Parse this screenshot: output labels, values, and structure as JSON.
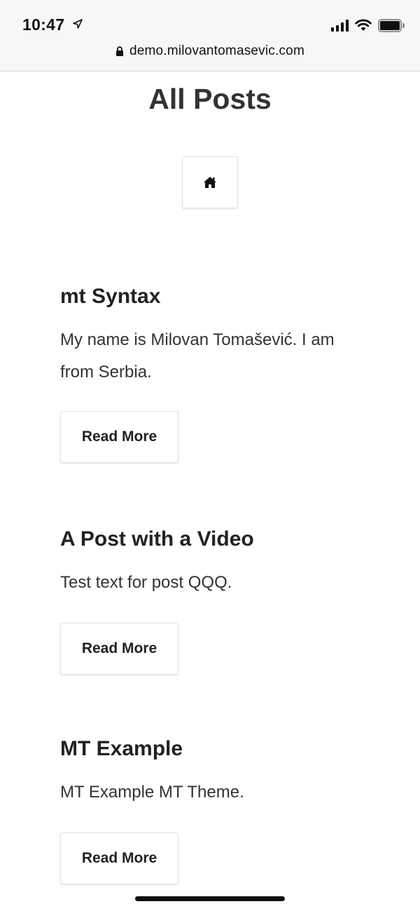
{
  "status_bar": {
    "time": "10:47"
  },
  "browser": {
    "url": "demo.milovantomasevic.com"
  },
  "page": {
    "title": "All Posts"
  },
  "posts": [
    {
      "title": "mt Syntax",
      "excerpt": "My name is Milovan Tomašević. I am from Serbia.",
      "button_label": "Read More"
    },
    {
      "title": "A Post with a Video",
      "excerpt": "Test text for post QQQ.",
      "button_label": "Read More"
    },
    {
      "title": "MT Example",
      "excerpt": "MT Example MT Theme.",
      "button_label": "Read More"
    }
  ],
  "icons": {
    "location": "location-arrow-icon",
    "signal": "cellular-signal-icon",
    "wifi": "wifi-icon",
    "battery": "battery-icon",
    "lock": "lock-icon",
    "home": "home-icon"
  }
}
